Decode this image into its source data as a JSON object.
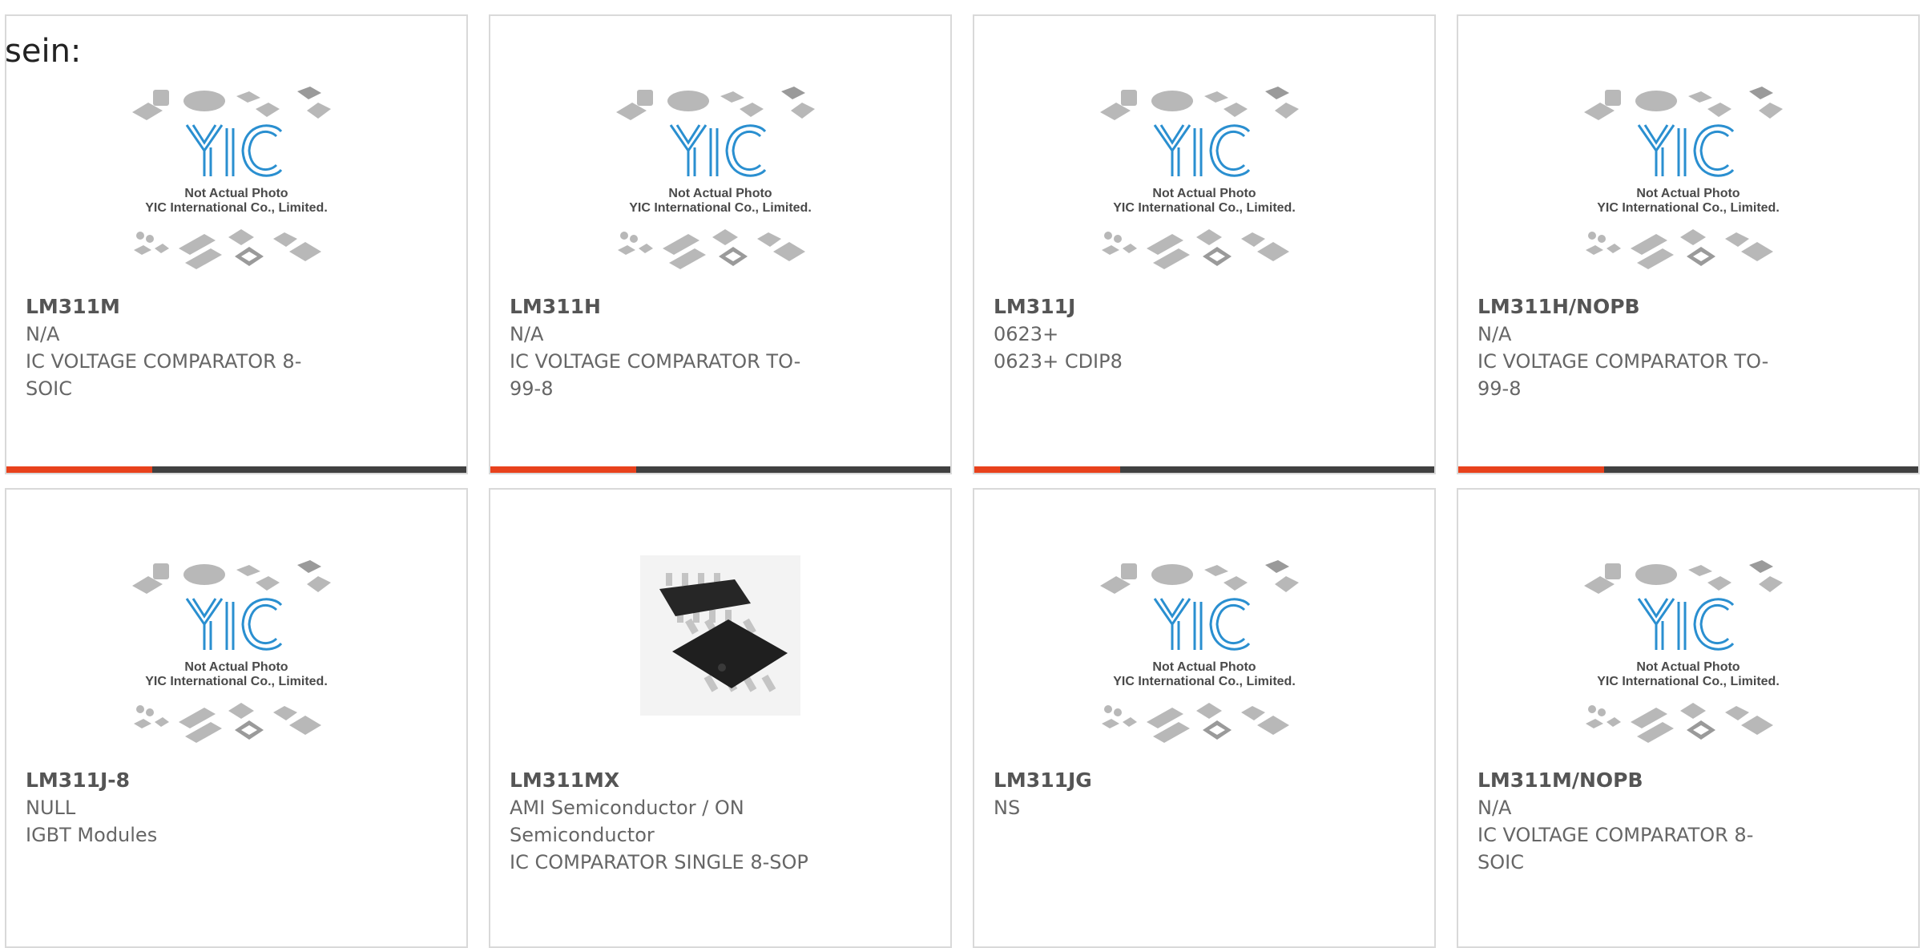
{
  "page": {
    "lead_text": "sein:"
  },
  "placeholder_image": {
    "logo_text": "YIC",
    "line1": "Not Actual Photo",
    "line2": "YIC International Co., Limited."
  },
  "products": [
    {
      "part": "LM311M",
      "brand": "N/A",
      "desc_line1": "IC VOLTAGE COMPARATOR 8-",
      "desc_line2": "SOIC",
      "desc_line3": "",
      "image": "placeholder-photo",
      "accent_bar": true
    },
    {
      "part": "LM311H",
      "brand": "N/A",
      "desc_line1": "IC VOLTAGE COMPARATOR TO-",
      "desc_line2": "99-8",
      "desc_line3": "",
      "image": "placeholder-photo",
      "accent_bar": true
    },
    {
      "part": "LM311J",
      "brand": "0623+",
      "desc_line1": "0623+ CDIP8",
      "desc_line2": "",
      "desc_line3": "",
      "image": "placeholder-photo",
      "accent_bar": true
    },
    {
      "part": "LM311H/NOPB",
      "brand": "N/A",
      "desc_line1": "IC VOLTAGE COMPARATOR TO-",
      "desc_line2": "99-8",
      "desc_line3": "",
      "image": "placeholder-photo",
      "accent_bar": true
    },
    {
      "part": "LM311J-8",
      "brand": "NULL",
      "desc_line1": "IGBT Modules",
      "desc_line2": "",
      "desc_line3": "",
      "image": "placeholder-photo",
      "accent_bar": false
    },
    {
      "part": "LM311MX",
      "brand": "AMI Semiconductor / ON",
      "desc_line1": "Semiconductor",
      "desc_line2": "IC COMPARATOR SINGLE 8-SOP",
      "desc_line3": "",
      "image": "soic-8-chip-photo",
      "accent_bar": false
    },
    {
      "part": "LM311JG",
      "brand": "NS",
      "desc_line1": "",
      "desc_line2": "",
      "desc_line3": "",
      "image": "placeholder-photo",
      "accent_bar": false
    },
    {
      "part": "LM311M/NOPB",
      "brand": "N/A",
      "desc_line1": "IC VOLTAGE COMPARATOR 8-",
      "desc_line2": "SOIC",
      "desc_line3": "",
      "image": "placeholder-photo",
      "accent_bar": false
    }
  ],
  "colors": {
    "accent": "#e8411c",
    "bar_dark": "#404040",
    "logo_blue": "#2a8fd0",
    "text_gray": "#666666"
  }
}
